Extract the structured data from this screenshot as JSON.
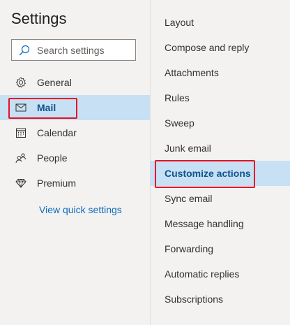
{
  "settings": {
    "title": "Settings",
    "search_placeholder": "Search settings",
    "nav": [
      {
        "label": "General",
        "icon": "gear-icon"
      },
      {
        "label": "Mail",
        "icon": "mail-icon",
        "selected": true
      },
      {
        "label": "Calendar",
        "icon": "calendar-icon"
      },
      {
        "label": "People",
        "icon": "people-icon"
      },
      {
        "label": "Premium",
        "icon": "diamond-icon"
      }
    ],
    "quick_settings_link": "View quick settings"
  },
  "mail_settings": {
    "items": [
      {
        "label": "Layout"
      },
      {
        "label": "Compose and reply"
      },
      {
        "label": "Attachments"
      },
      {
        "label": "Rules"
      },
      {
        "label": "Sweep"
      },
      {
        "label": "Junk email"
      },
      {
        "label": "Customize actions",
        "selected": true
      },
      {
        "label": "Sync email"
      },
      {
        "label": "Message handling"
      },
      {
        "label": "Forwarding"
      },
      {
        "label": "Automatic replies"
      },
      {
        "label": "Subscriptions"
      }
    ]
  },
  "colors": {
    "pane_background": "#f3f2f1",
    "selected_background": "#c7e0f4",
    "selected_text": "#0f548c",
    "link": "#0f6cbd",
    "highlight_border": "#e81123"
  }
}
